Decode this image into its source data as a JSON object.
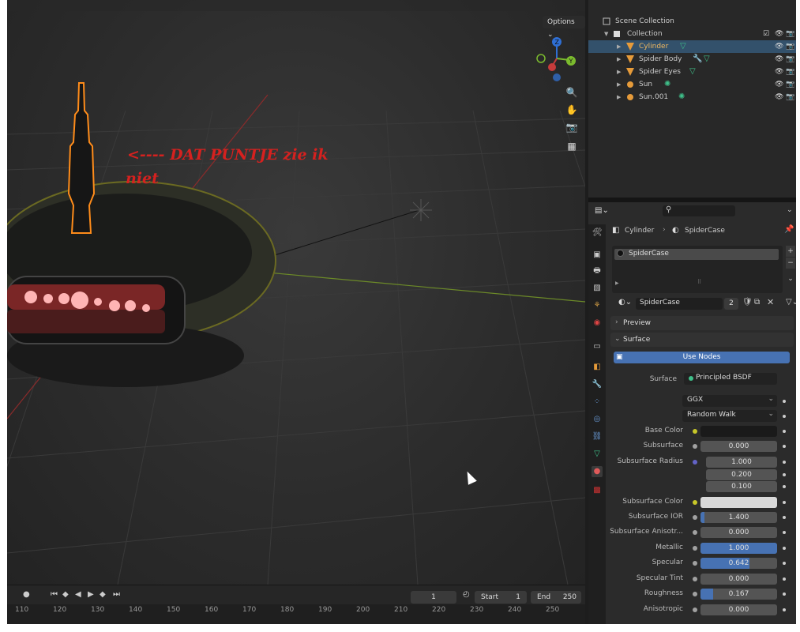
{
  "viewport": {
    "options_label": "Options ⌄",
    "annotation_line1": "<---- DAT PUNTJE  zie ik",
    "annotation_line2": "niet",
    "gizmo": {
      "z": "Z",
      "y": "Y"
    }
  },
  "timeline": {
    "current_frame": "1",
    "start_label": "Start",
    "start_value": "1",
    "end_label": "End",
    "end_value": "250",
    "ruler": [
      "110",
      "120",
      "130",
      "140",
      "150",
      "160",
      "170",
      "180",
      "190",
      "200",
      "210",
      "220",
      "230",
      "240",
      "250"
    ]
  },
  "outliner": {
    "rows": [
      {
        "label": "Scene Collection",
        "icon": "scene-collection-icon"
      },
      {
        "label": "Collection",
        "icon": "collection-icon"
      },
      {
        "label": "Cylinder",
        "icon": "mesh-object-icon",
        "selected": true
      },
      {
        "label": "Spider Body",
        "icon": "mesh-object-icon"
      },
      {
        "label": "Spider Eyes",
        "icon": "mesh-object-icon"
      },
      {
        "label": "Sun",
        "icon": "light-icon"
      },
      {
        "label": "Sun.001",
        "icon": "light-icon"
      }
    ]
  },
  "properties": {
    "breadcrumb_object": "Cylinder",
    "breadcrumb_material": "SpiderCase",
    "slot_name": "SpiderCase",
    "material_name": "SpiderCase",
    "user_count": "2",
    "preview_label": "Preview",
    "surface_label": "Surface",
    "use_nodes_label": "Use Nodes",
    "shader_label": "Surface",
    "shader_value": "Principled BSDF",
    "distribution": "GGX",
    "subsurface_method": "Random Walk",
    "fields": [
      {
        "label": "Base Color",
        "type": "color",
        "value": ""
      },
      {
        "label": "Subsurface",
        "value": "0.000",
        "fraction": 0
      },
      {
        "label": "Subsurface Radius",
        "value": "1.000"
      },
      {
        "label": "",
        "value": "0.200"
      },
      {
        "label": "",
        "value": "0.100"
      },
      {
        "label": "Subsurface Color",
        "type": "color",
        "value": ""
      },
      {
        "label": "Subsurface IOR",
        "value": "1.400",
        "fraction": 0.05
      },
      {
        "label": "Subsurface Anisotr...",
        "value": "0.000",
        "fraction": 0
      },
      {
        "label": "Metallic",
        "value": "1.000",
        "fraction": 1.0
      },
      {
        "label": "Specular",
        "value": "0.642",
        "fraction": 0.642
      },
      {
        "label": "Specular Tint",
        "value": "0.000",
        "fraction": 0
      },
      {
        "label": "Roughness",
        "value": "0.167",
        "fraction": 0.167
      },
      {
        "label": "Anisotropic",
        "value": "0.000",
        "fraction": 0
      }
    ]
  },
  "colors": {
    "selection": "#33516b",
    "accent_blue": "#4772b3",
    "annotation_red": "#d6211f",
    "outline_orange": "#ff8c1a"
  }
}
